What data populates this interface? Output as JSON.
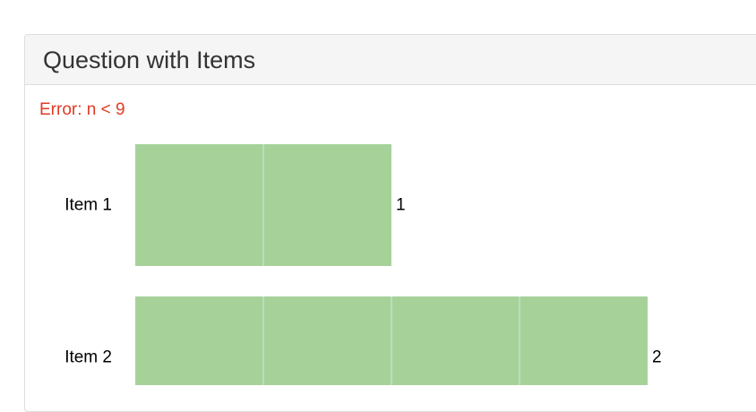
{
  "panel": {
    "title": "Question with Items"
  },
  "error_message": "Error: n < 9",
  "colors": {
    "bar": "#a6d29a",
    "bar_divider": "#c4e2bc",
    "error": "#e03b24"
  },
  "chart_data": {
    "type": "bar",
    "orientation": "horizontal",
    "categories": [
      "Item 1",
      "Item 2"
    ],
    "values": [
      1,
      2
    ],
    "data_labels": [
      "1",
      "2"
    ],
    "title": "",
    "xlabel": "",
    "ylabel": "",
    "xlim": [
      0,
      2
    ]
  }
}
